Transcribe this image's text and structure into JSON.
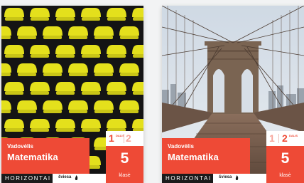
{
  "books": [
    {
      "label": "Vadovėlis",
      "title": "Matematika",
      "part_current": "1",
      "part_sub": "DALIS",
      "part_other": "2",
      "grade": "5",
      "grade_label": "klasė",
      "brand": "HORIZONTAI",
      "publisher": "šviesa",
      "cover_image": "yellow-stadium-seats"
    },
    {
      "label": "Vadovėlis",
      "title": "Matematika",
      "part_current": "2",
      "part_sub": "DALIS",
      "part_other": "1",
      "grade": "5",
      "grade_label": "klasė",
      "brand": "HORIZONTAI",
      "publisher": "šviesa",
      "cover_image": "brooklyn-bridge"
    }
  ],
  "colors": {
    "accent": "#ee4a36",
    "background": "#f2f3f4",
    "seat_yellow": "#e4e01c",
    "brand_dark": "#1b1b1b"
  }
}
